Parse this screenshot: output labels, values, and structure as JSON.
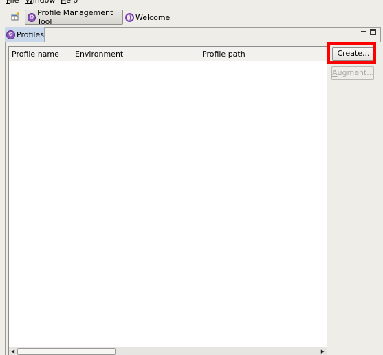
{
  "menu": {
    "items": [
      {
        "mnemonic": "F",
        "rest": "ile"
      },
      {
        "mnemonic": "W",
        "rest": "indow"
      },
      {
        "mnemonic": "H",
        "rest": "elp"
      }
    ]
  },
  "toolbar": {
    "open_perspective_icon": "open-perspective-icon",
    "tabs": {
      "pmt_label": "Profile Management Tool",
      "welcome_label": "Welcome"
    }
  },
  "view": {
    "tab_label": "Profiles",
    "table": {
      "columns": [
        "Profile name",
        "Environment",
        "Profile path"
      ],
      "rows": []
    },
    "buttons": {
      "create": {
        "mnemonic": "C",
        "rest": "reate..."
      },
      "augment": {
        "mnemonic": "A",
        "rest": "ugment..."
      }
    }
  },
  "colors": {
    "highlight": "#ff0000",
    "view_tab": "#c8d8ea",
    "icon_purple": "#8b57b8"
  }
}
